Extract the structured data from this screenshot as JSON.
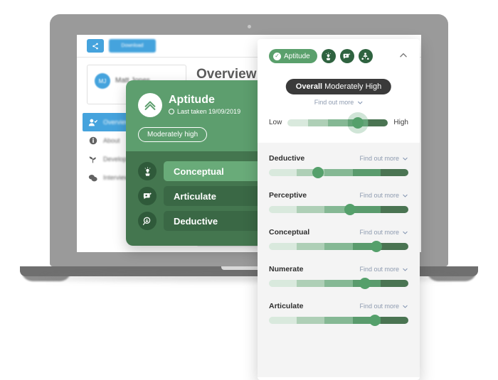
{
  "background_app": {
    "share_button": "share-icon",
    "download_button": "Download",
    "person": {
      "initials": "MJ",
      "name": "Matt Jones"
    },
    "page_title": "Overview",
    "nav_items": [
      {
        "label": "Overview",
        "icon": "user-check-icon",
        "active": true
      },
      {
        "label": "About",
        "icon": "info-icon",
        "active": false
      },
      {
        "label": "Development",
        "icon": "sprout-icon",
        "active": false
      },
      {
        "label": "Interview",
        "icon": "chat-icon",
        "active": false
      }
    ]
  },
  "green_card": {
    "icon": "aptitude-chevron-icon",
    "title": "Aptitude",
    "last_taken_label": "Last taken 19/09/2019",
    "level_badge": "Moderately high",
    "rows": [
      {
        "label": "Conceptual",
        "icon": "plant-idea-icon",
        "style": "light"
      },
      {
        "label": "Articulate",
        "icon": "speech-bubble-icon",
        "style": "dark"
      },
      {
        "label": "Deductive",
        "icon": "magnifier-icon",
        "style": "dark"
      }
    ]
  },
  "panel": {
    "chip": {
      "label": "Aptitude",
      "icon": "check-circle-icon"
    },
    "category_icons": [
      "plant-idea-icon",
      "speech-bubble-icon",
      "numerate-icon"
    ],
    "collapse_icon": "chevron-up-icon",
    "overall": {
      "prefix": "Overall",
      "value": "Moderately High"
    },
    "find_out_more": "Find out more",
    "chevron_icon": "chevron-down-icon",
    "scale": {
      "low": "Low",
      "high": "High"
    },
    "overall_slider": {
      "position_pct": 70
    },
    "metrics": [
      {
        "name": "Deductive",
        "find_out_more": "Find out more",
        "position_pct": 35
      },
      {
        "name": "Perceptive",
        "find_out_more": "Find out more",
        "position_pct": 58
      },
      {
        "name": "Conceptual",
        "find_out_more": "Find out more",
        "position_pct": 77
      },
      {
        "name": "Numerate",
        "find_out_more": "Find out more",
        "position_pct": 69
      },
      {
        "name": "Articulate",
        "find_out_more": "Find out more",
        "position_pct": 76
      }
    ]
  },
  "colors": {
    "segment_1": "#d9e9dd",
    "segment_2": "#aecfb6",
    "segment_3": "#85b894",
    "segment_4": "#5a9b6d",
    "segment_5": "#4a7452",
    "thumb": "#55a06b",
    "card_top": "#5d9e6e",
    "card_bottom": "#44764f",
    "accent_blue": "#45a3dd",
    "pill_dark": "#3a3a3a"
  }
}
